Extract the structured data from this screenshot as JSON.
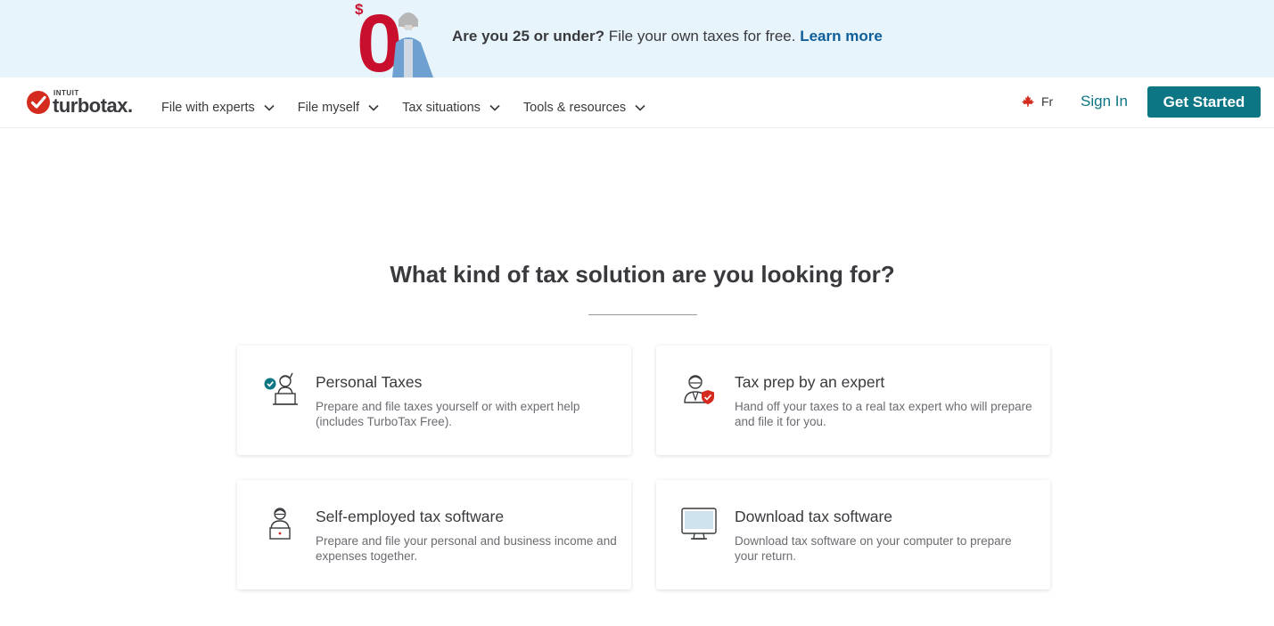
{
  "promo": {
    "headline_bold": "Are you 25 or under?",
    "headline_rest": " File your own taxes for free. ",
    "link": "Learn more",
    "art_dollar": "$",
    "art_zero": "0"
  },
  "header": {
    "logo_intuit": "INTUIT",
    "logo_name": "turbotax.",
    "nav": [
      {
        "label": "File with experts"
      },
      {
        "label": "File myself"
      },
      {
        "label": "Tax situations"
      },
      {
        "label": "Tools & resources"
      }
    ],
    "lang_label": "Fr",
    "signin": "Sign In",
    "get_started": "Get Started"
  },
  "main": {
    "headline": "What kind of tax solution are you looking for?",
    "cards": [
      {
        "title": "Personal Taxes",
        "desc": "Prepare and file taxes yourself or with expert help (includes TurboTax Free).",
        "icon": "person-laptop-check-icon"
      },
      {
        "title": "Tax prep by an expert",
        "desc": "Hand off your taxes to a real tax expert who will prepare and file it for you.",
        "icon": "expert-shield-icon"
      },
      {
        "title": "Self-employed tax software",
        "desc": "Prepare and file your personal and business income and expenses together.",
        "icon": "self-employed-person-icon"
      },
      {
        "title": "Download tax software",
        "desc": "Download tax software on your computer to prepare your return.",
        "icon": "desktop-monitor-icon"
      }
    ]
  },
  "colors": {
    "accent": "#0d7684",
    "link": "#0d5e9b",
    "banner_bg": "#e8f4fb",
    "brand_red": "#d52b1e"
  }
}
